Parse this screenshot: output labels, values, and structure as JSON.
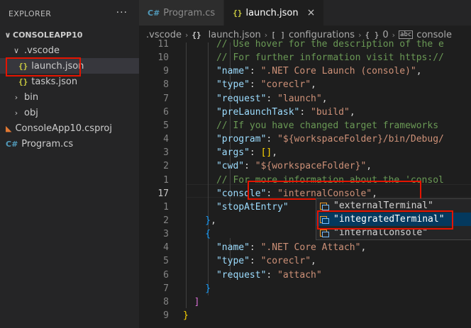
{
  "sidebar": {
    "title": "EXPLORER",
    "more": "···",
    "project": "CONSOLEAPP10",
    "items": [
      {
        "label": ".vscode",
        "chev": "∨",
        "icon": ""
      },
      {
        "label": "launch.json",
        "chev": "",
        "icon": "{}"
      },
      {
        "label": "tasks.json",
        "chev": "",
        "icon": "{}"
      },
      {
        "label": "bin",
        "chev": "›",
        "icon": ""
      },
      {
        "label": "obj",
        "chev": "›",
        "icon": ""
      },
      {
        "label": "ConsoleApp10.csproj",
        "chev": "",
        "icon": "rss"
      },
      {
        "label": "Program.cs",
        "chev": "",
        "icon": "C#"
      }
    ]
  },
  "tabs": [
    {
      "label": "Program.cs",
      "icon": "C#"
    },
    {
      "label": "launch.json",
      "icon": "{}",
      "close": "×"
    }
  ],
  "breadcrumb": {
    "items": [
      ".vscode",
      "launch.json",
      "configurations",
      "0",
      "console"
    ],
    "icons": [
      "",
      "{}",
      "[ ]",
      "{ }",
      "abc"
    ]
  },
  "editor": {
    "lines": [
      {
        "num": "11",
        "segments": [
          [
            "comment",
            "      // Use hover for the description of the e"
          ]
        ]
      },
      {
        "num": "10",
        "segments": [
          [
            "comment",
            "      // For further information visit https://"
          ]
        ]
      },
      {
        "num": "9",
        "segments": [
          [
            "key",
            "      \"name\""
          ],
          [
            "punct",
            ": "
          ],
          [
            "str",
            "\".NET Core Launch (console)\""
          ],
          [
            "punct",
            ","
          ]
        ]
      },
      {
        "num": "8",
        "segments": [
          [
            "key",
            "      \"type\""
          ],
          [
            "punct",
            ": "
          ],
          [
            "str",
            "\"coreclr\""
          ],
          [
            "punct",
            ","
          ]
        ]
      },
      {
        "num": "7",
        "segments": [
          [
            "key",
            "      \"request\""
          ],
          [
            "punct",
            ": "
          ],
          [
            "str",
            "\"launch\""
          ],
          [
            "punct",
            ","
          ]
        ]
      },
      {
        "num": "6",
        "segments": [
          [
            "key",
            "      \"preLaunchTask\""
          ],
          [
            "punct",
            ": "
          ],
          [
            "str",
            "\"build\""
          ],
          [
            "punct",
            ","
          ]
        ]
      },
      {
        "num": "5",
        "segments": [
          [
            "comment",
            "      // If you have changed target frameworks"
          ]
        ]
      },
      {
        "num": "4",
        "segments": [
          [
            "key",
            "      \"program\""
          ],
          [
            "punct",
            ": "
          ],
          [
            "str",
            "\"${workspaceFolder}/bin/Debug/"
          ]
        ]
      },
      {
        "num": "3",
        "segments": [
          [
            "key",
            "      \"args\""
          ],
          [
            "punct",
            ": "
          ],
          [
            "brace3",
            "[]"
          ],
          [
            "punct",
            ","
          ]
        ]
      },
      {
        "num": "2",
        "segments": [
          [
            "key",
            "      \"cwd\""
          ],
          [
            "punct",
            ": "
          ],
          [
            "str",
            "\"${workspaceFolder}\""
          ],
          [
            "punct",
            ","
          ]
        ]
      },
      {
        "num": "1",
        "segments": [
          [
            "comment",
            "      // For more information about the 'consol"
          ]
        ]
      },
      {
        "num": "17",
        "segments": [
          [
            "key",
            "      \"console\""
          ],
          [
            "punct",
            ": "
          ],
          [
            "str",
            "\"internalConsole\""
          ],
          [
            "punct",
            ","
          ]
        ]
      },
      {
        "num": "1",
        "segments": [
          [
            "key",
            "      \"stopAtEntry\""
          ]
        ]
      },
      {
        "num": "2",
        "segments": [
          [
            "brace2",
            "    }"
          ],
          [
            "punct",
            ","
          ]
        ]
      },
      {
        "num": "3",
        "segments": [
          [
            "brace2",
            "    {"
          ]
        ]
      },
      {
        "num": "4",
        "segments": [
          [
            "key",
            "      \"name\""
          ],
          [
            "punct",
            ": "
          ],
          [
            "str",
            "\".NET Core Attach\""
          ],
          [
            "punct",
            ","
          ]
        ]
      },
      {
        "num": "5",
        "segments": [
          [
            "key",
            "      \"type\""
          ],
          [
            "punct",
            ": "
          ],
          [
            "str",
            "\"coreclr\""
          ],
          [
            "punct",
            ","
          ]
        ]
      },
      {
        "num": "6",
        "segments": [
          [
            "key",
            "      \"request\""
          ],
          [
            "punct",
            ": "
          ],
          [
            "str",
            "\"attach\""
          ]
        ]
      },
      {
        "num": "7",
        "segments": [
          [
            "brace2",
            "    }"
          ]
        ]
      },
      {
        "num": "8",
        "segments": [
          [
            "brace1",
            "  ]"
          ]
        ]
      },
      {
        "num": "9",
        "segments": [
          [
            "brace3",
            "}"
          ]
        ]
      }
    ]
  },
  "suggest": {
    "items": [
      "\"externalTerminal\"",
      "\"integratedTerminal\"",
      "\"internalConsole\""
    ],
    "focused": 1
  },
  "colors": {
    "highlight_box": "#e51400",
    "focus_bg": "#04395e"
  }
}
